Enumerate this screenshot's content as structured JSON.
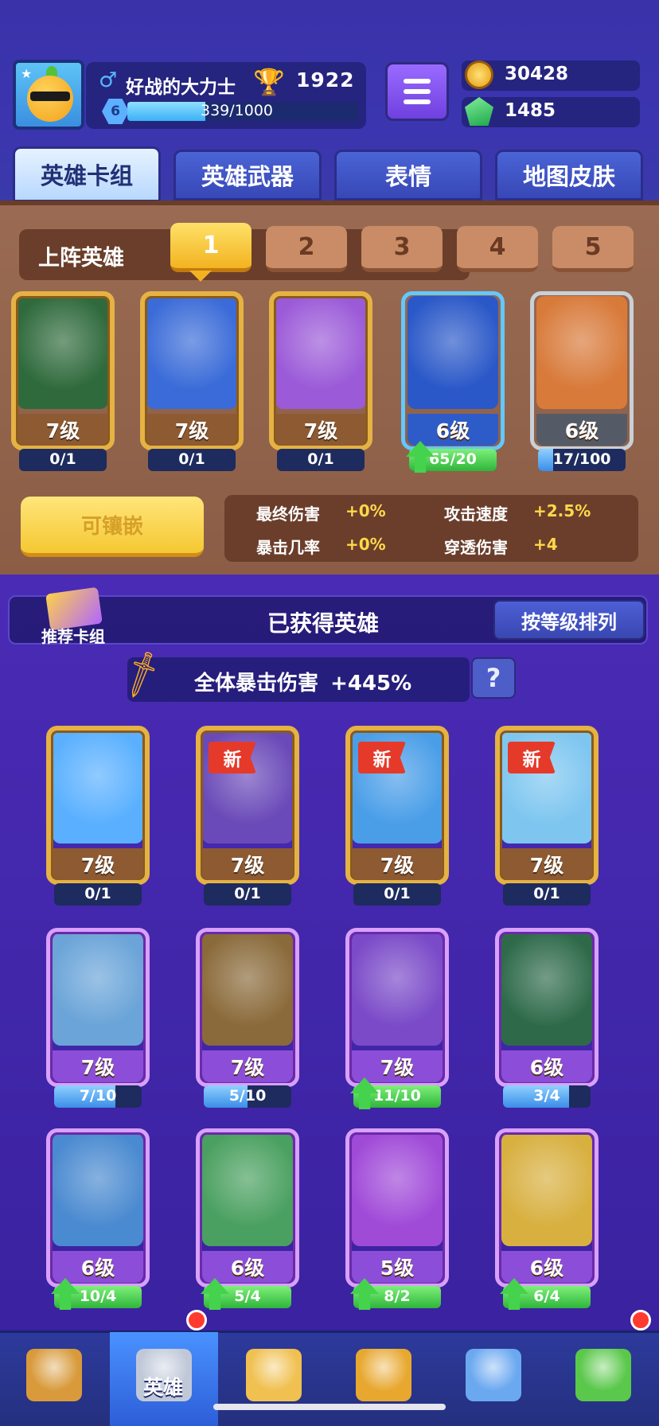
{
  "profile": {
    "name": "好战的大力士",
    "level": "6",
    "trophies": "1922",
    "xp_text": "339/1000",
    "xp_fraction": 0.339
  },
  "currency": {
    "coins": "30428",
    "gems": "1485"
  },
  "tabs": [
    "英雄卡组",
    "英雄武器",
    "表情",
    "地图皮肤"
  ],
  "deck": {
    "label": "上阵英雄",
    "slots": [
      "1",
      "2",
      "3",
      "4",
      "5"
    ],
    "heroes": [
      {
        "level": "7级",
        "progress": "0/1",
        "fraction": 0,
        "style": "gold",
        "art": "#2f6a3c",
        "upgrade": false
      },
      {
        "level": "7级",
        "progress": "0/1",
        "fraction": 0,
        "style": "gold",
        "art": "#3a6bd8",
        "upgrade": false
      },
      {
        "level": "7级",
        "progress": "0/1",
        "fraction": 0,
        "style": "gold",
        "art": "#9b5ad8",
        "upgrade": false
      },
      {
        "level": "6级",
        "progress": "65/20",
        "fraction": 1,
        "style": "blue",
        "art": "#2a58c8",
        "upgrade": true
      },
      {
        "level": "6级",
        "progress": "17/100",
        "fraction": 0.17,
        "style": "grey",
        "art": "#d87a3a",
        "upgrade": false
      }
    ]
  },
  "inlay": {
    "button": "可镶嵌",
    "stats": [
      {
        "label": "最终伤害",
        "value": "+0%"
      },
      {
        "label": "攻击速度",
        "value": "+2.5%"
      },
      {
        "label": "暴击几率",
        "value": "+0%"
      },
      {
        "label": "穿透伤害",
        "value": "+4"
      }
    ]
  },
  "owned": {
    "recommend_label": "推荐卡组",
    "title": "已获得英雄",
    "sort_label": "按等级排列",
    "crit_text": "全体暴击伤害",
    "crit_value": "+445%",
    "help": "?",
    "new_tag": "新",
    "heroes": [
      {
        "level": "7级",
        "progress": "0/1",
        "fraction": 0,
        "style": "gold",
        "art": "#5ab0ff",
        "upgrade": false,
        "new": false
      },
      {
        "level": "7级",
        "progress": "0/1",
        "fraction": 0,
        "style": "gold",
        "art": "#6a4ab8",
        "upgrade": false,
        "new": true
      },
      {
        "level": "7级",
        "progress": "0/1",
        "fraction": 0,
        "style": "gold",
        "art": "#4a9ee8",
        "upgrade": false,
        "new": true
      },
      {
        "level": "7级",
        "progress": "0/1",
        "fraction": 0,
        "style": "gold",
        "art": "#7ec6f0",
        "upgrade": false,
        "new": true
      },
      {
        "level": "7级",
        "progress": "7/10",
        "fraction": 0.7,
        "style": "purple",
        "art": "#6aa4d8",
        "upgrade": false,
        "new": false
      },
      {
        "level": "7级",
        "progress": "5/10",
        "fraction": 0.5,
        "style": "purple",
        "art": "#8a6a3a",
        "upgrade": false,
        "new": false
      },
      {
        "level": "7级",
        "progress": "11/10",
        "fraction": 1,
        "style": "purple",
        "art": "#7a4ac8",
        "upgrade": true,
        "new": false
      },
      {
        "level": "6级",
        "progress": "3/4",
        "fraction": 0.75,
        "style": "purple",
        "art": "#2e6a4a",
        "upgrade": false,
        "new": false
      },
      {
        "level": "6级",
        "progress": "10/4",
        "fraction": 1,
        "style": "purple",
        "art": "#4a8ad0",
        "upgrade": true,
        "new": false
      },
      {
        "level": "6级",
        "progress": "5/4",
        "fraction": 1,
        "style": "purple",
        "art": "#4aa060",
        "upgrade": true,
        "new": false
      },
      {
        "level": "5级",
        "progress": "8/2",
        "fraction": 1,
        "style": "purple",
        "art": "#a04ad8",
        "upgrade": true,
        "new": false
      },
      {
        "level": "6级",
        "progress": "6/4",
        "fraction": 1,
        "style": "purple",
        "art": "#d8b040",
        "upgrade": true,
        "new": false
      }
    ]
  },
  "bottom_nav": {
    "items": [
      {
        "icon": "treasure-chest-icon",
        "label": "",
        "active": false
      },
      {
        "icon": "knight-helmet-icon",
        "label": "英雄",
        "active": true
      },
      {
        "icon": "crossed-swords-icon",
        "label": "",
        "active": false
      },
      {
        "icon": "crown-shield-icon",
        "label": "",
        "active": false
      },
      {
        "icon": "team-banner-icon",
        "label": "",
        "active": false
      },
      {
        "icon": "sprout-island-icon",
        "label": "",
        "active": false
      }
    ]
  },
  "colors": {
    "background": "#3b2aa0",
    "accent_gold": "#f2b321",
    "progress_green": "#45d24c",
    "progress_blue": "#4aa8f0",
    "stat_yellow": "#ffd84a"
  }
}
